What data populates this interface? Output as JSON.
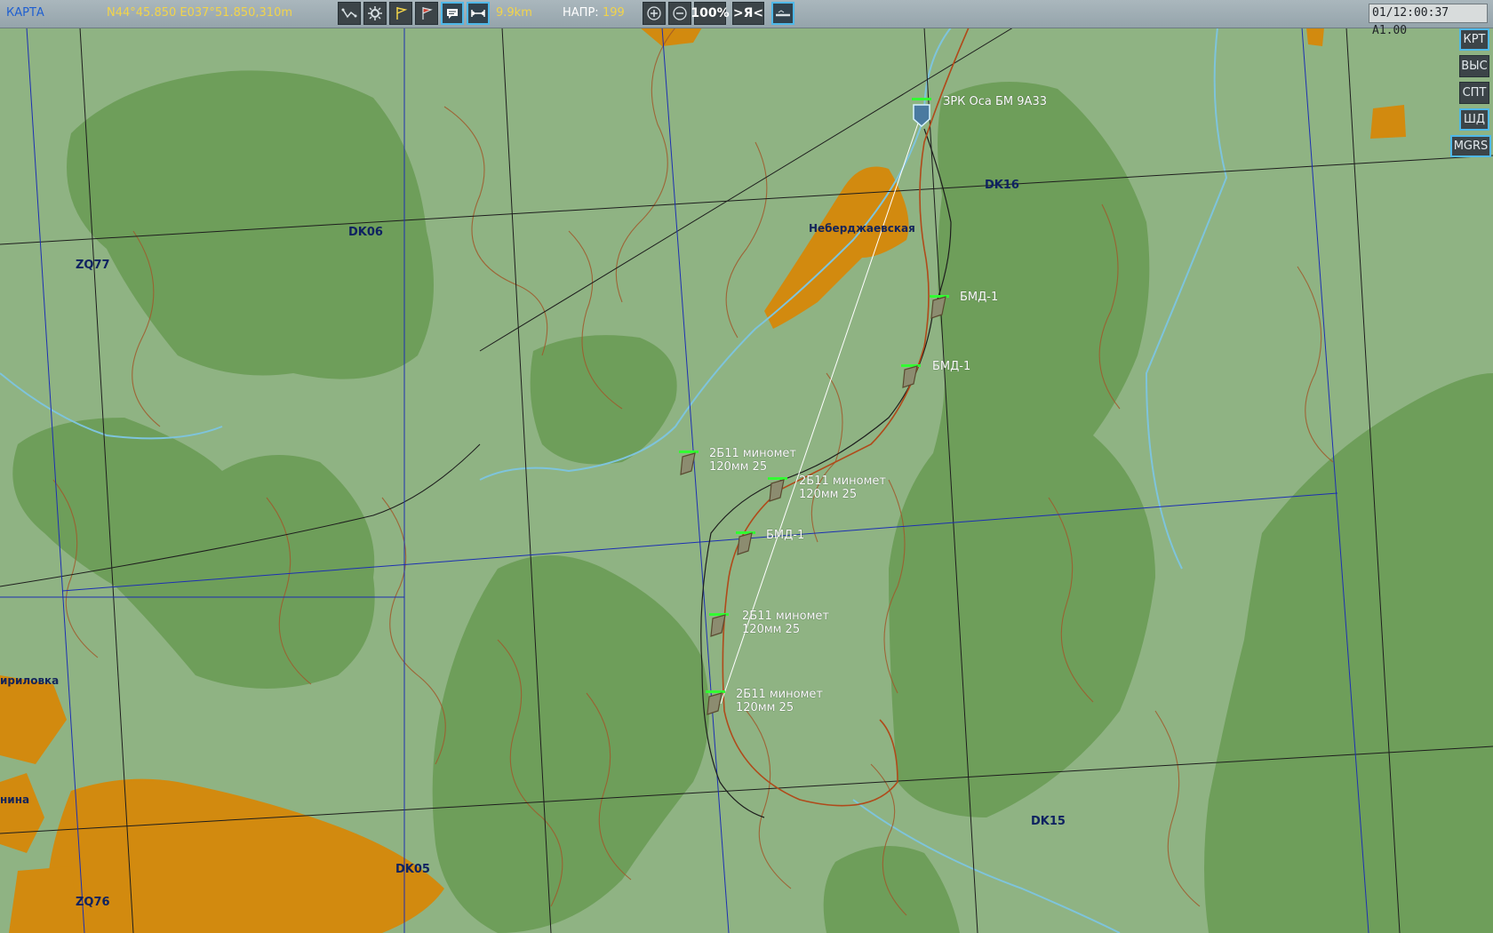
{
  "topbar": {
    "map_label": "КАРТА",
    "coordinates": "N44°45.850 E037°51.850,310m",
    "distance": "9.9km",
    "heading_label": "НАПР:",
    "heading_value": "199",
    "zoom": "100%",
    "center_self": ">Я<",
    "clock": "01/12:00:37 A1.00"
  },
  "sidebar": {
    "items": [
      {
        "label": "КРТ"
      },
      {
        "label": "ВЫС"
      },
      {
        "label": "СПТ"
      },
      {
        "label": "ШД"
      },
      {
        "label": "MGRS"
      }
    ]
  },
  "colors": {
    "map_base": "#8fb383",
    "forest": "#6e9e5a",
    "town": "#d28a0f",
    "river": "#7ec4dc",
    "contour": "#a0582a",
    "grid_blue": "#1c2fb2",
    "grid_black": "#1d1d1d",
    "unit_health": "#32ff32",
    "coordinate_text": "#f2d44a"
  },
  "map": {
    "grid_labels": [
      "DK06",
      "ZQ77",
      "DK16",
      "DK15",
      "DK05",
      "ZQ76"
    ],
    "towns": [
      "Неберджаевская",
      "ириловка",
      "нина"
    ],
    "units": [
      {
        "name": "ЗРК Оса БМ 9А33",
        "line2": ""
      },
      {
        "name": "БМД-1",
        "line2": ""
      },
      {
        "name": "БМД-1",
        "line2": ""
      },
      {
        "name": "2Б11 миномет",
        "line2": "120мм  25"
      },
      {
        "name": "2Б11 миномет",
        "line2": "120мм  25"
      },
      {
        "name": "БМД-1",
        "line2": ""
      },
      {
        "name": "2Б11 миномет",
        "line2": "120мм  25"
      },
      {
        "name": "2Б11 миномет",
        "line2": "120мм  25"
      }
    ]
  }
}
